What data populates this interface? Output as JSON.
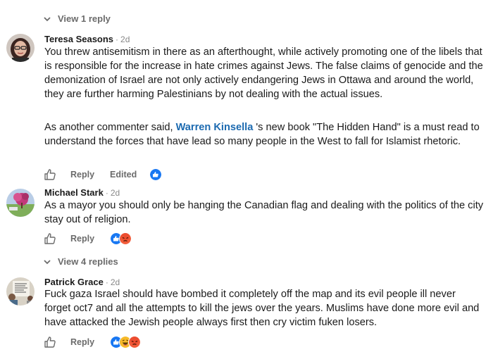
{
  "threads": {
    "top_view_replies": "View 1 reply",
    "mid_view_replies": "View 4 replies"
  },
  "comments": [
    {
      "author": "Teresa Seasons",
      "age": "2d",
      "paragraphs": [
        "You threw antisemitism in there as an afterthought, while actively promoting one of the libels that is responsible for the increase in hate crimes against Jews. The false claims of genocide and the demonization of Israel are not only actively endangering Jews in Ottawa and around the world, they are further harming Palestinians by not dealing with the actual issues."
      ],
      "para2_before": "As another commenter said, ",
      "mention": "Warren Kinsella",
      "para2_after": " 's new book \"The Hidden Hand\" is a must read to understand the forces that have lead so many people in the West to fall for Islamist rhetoric.",
      "reply_label": "Reply",
      "edited_label": "Edited",
      "reactions": [
        "like"
      ]
    },
    {
      "author": "Michael Stark",
      "age": "2d",
      "text": "As a mayor you should only be hanging the Canadian flag and dealing with the politics of the city stay out of religion.",
      "reply_label": "Reply",
      "reactions": [
        "like",
        "angry"
      ]
    },
    {
      "author": "Patrick Grace",
      "age": "2d",
      "text": "Fuck gaza Israel should have bombed it completely off the map and its evil people ill never forget oct7 and all the attempts to kill the jews over the years. Muslims have done more evil and have attacked the Jewish people always first then cry victim fuken losers.",
      "reply_label": "Reply",
      "reactions": [
        "like",
        "laugh",
        "angry"
      ]
    }
  ],
  "separator": "·",
  "colors": {
    "like_blue": "#1877f2",
    "mention_blue": "#1c6ab0",
    "angry": "#f25c3a",
    "laugh": "#f7b928"
  }
}
